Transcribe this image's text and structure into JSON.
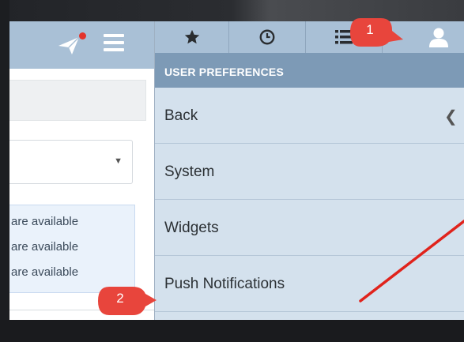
{
  "panel": {
    "header_title": "USER PREFERENCES",
    "menu_items": [
      "Back",
      "System",
      "Widgets",
      "Push Notifications"
    ]
  },
  "info": {
    "lines": [
      "are available",
      "are available",
      "are available"
    ]
  },
  "callouts": {
    "one": "1",
    "two": "2"
  },
  "colors": {
    "header_blue": "#a9c0d6",
    "section_blue": "#7d9ab6",
    "panel_bg": "#d4e1ed",
    "callout_red": "#e8453c",
    "arrow_red": "#e0231c",
    "notification_dot": "#e3332b"
  },
  "icons": {
    "tab_1": "star-icon",
    "tab_2": "clock-icon",
    "tab_3": "list-icon",
    "tab_4": "user-icon",
    "header_left": "send-icon",
    "header_right": "hamburger-menu-icon",
    "select": "caret-down-icon",
    "back_item": "chevron-left-icon"
  }
}
